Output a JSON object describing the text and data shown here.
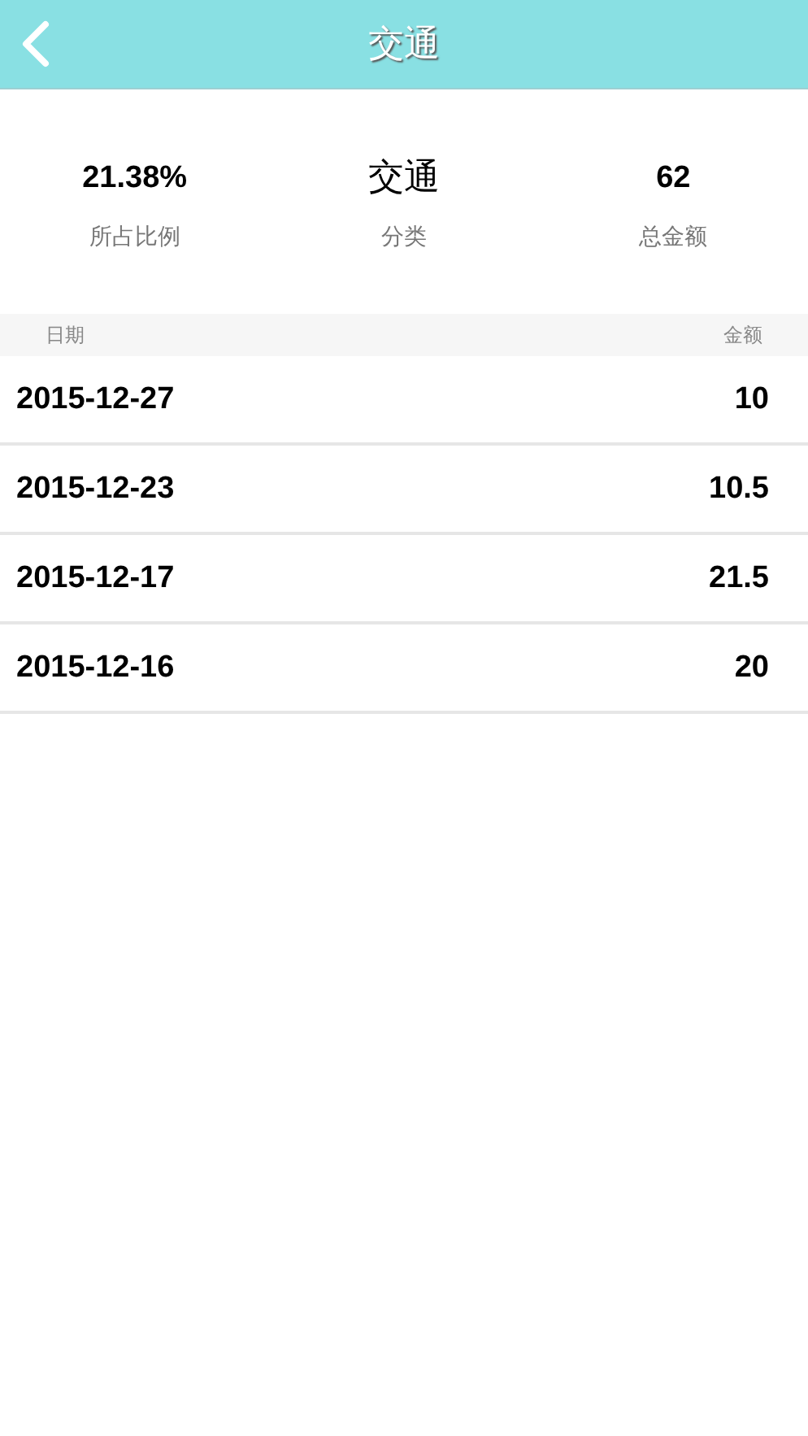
{
  "header": {
    "title": "交通"
  },
  "summary": [
    {
      "value": "21.38%",
      "label": "所占比例",
      "kind": "number"
    },
    {
      "value": "交通",
      "label": "分类",
      "kind": "category"
    },
    {
      "value": "62",
      "label": "总金额",
      "kind": "number"
    }
  ],
  "table": {
    "columns": [
      "日期",
      "金额"
    ],
    "rows": [
      {
        "date": "2015-12-27",
        "amount": "10"
      },
      {
        "date": "2015-12-23",
        "amount": "10.5"
      },
      {
        "date": "2015-12-17",
        "amount": "21.5"
      },
      {
        "date": "2015-12-16",
        "amount": "20"
      }
    ]
  }
}
